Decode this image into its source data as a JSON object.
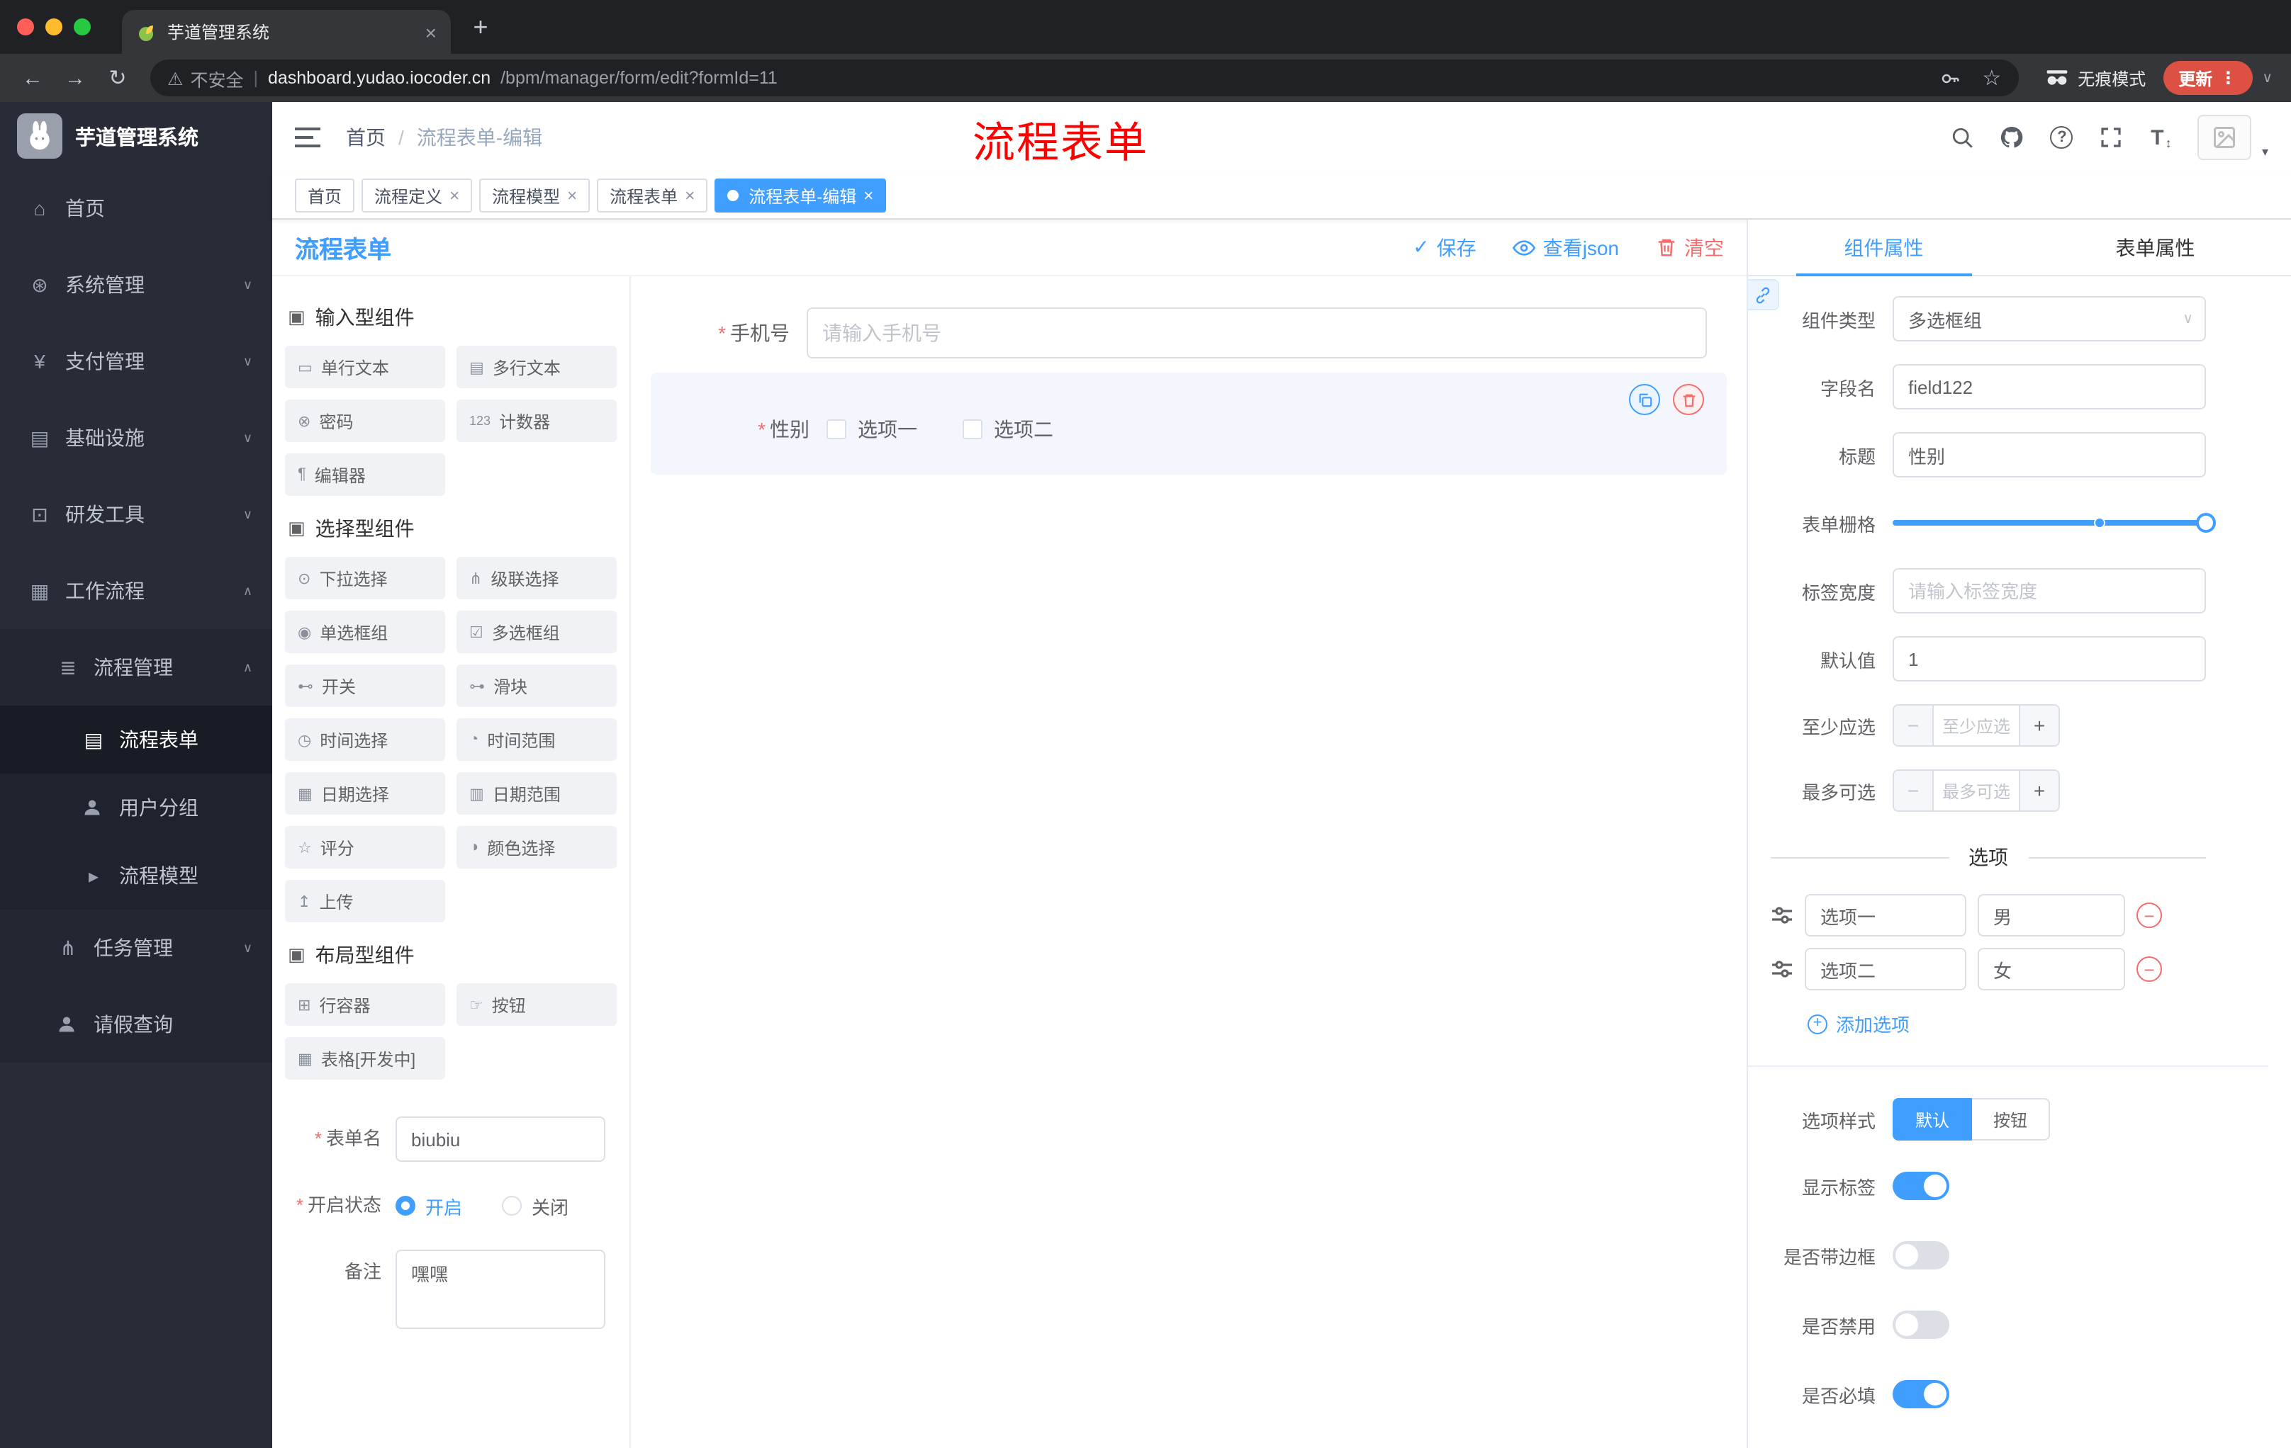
{
  "colors": {
    "accent": "#409EFF",
    "danger": "#F56C6C",
    "annotation_red": "#FF0000",
    "sidebar_bg": "#282C37",
    "update_button": "#DD5144",
    "tag_active": "#409EFF"
  },
  "ui": {
    "close": "×",
    "plus": "+",
    "minus": "−",
    "kebab": "⋮",
    "chevron_down": "∨",
    "caret_down": "▾",
    "check": "✓",
    "star": "☆",
    "back": "←",
    "forward": "→",
    "reload": "↻",
    "pipe": "|",
    "warning": "⚠",
    "updown": "↕",
    "help": "?",
    "font_big": "T",
    "font_small": "T"
  },
  "browser": {
    "tab_title": "芋道管理系统",
    "security_label": "不安全",
    "url_domain": "dashboard.yudao.iocoder.cn",
    "url_path": "/bpm/manager/form/edit?formId=11",
    "incognito_label": "无痕模式",
    "update_label": "更新"
  },
  "sidebar": {
    "logo_title": "芋道管理系统",
    "items": [
      {
        "label": "首页",
        "glyph": "⌂"
      },
      {
        "label": "系统管理",
        "glyph": "⊛",
        "arrow": "∨"
      },
      {
        "label": "支付管理",
        "glyph": "¥",
        "arrow": "∨"
      },
      {
        "label": "基础设施",
        "glyph": "▤",
        "arrow": "∨"
      },
      {
        "label": "研发工具",
        "glyph": "⊡",
        "arrow": "∨"
      },
      {
        "label": "工作流程",
        "glyph": "▦",
        "arrow": "∧"
      },
      {
        "label": "流程管理",
        "glyph": "≣",
        "arrow": "∧"
      },
      {
        "label": "流程表单",
        "glyph": "▤"
      },
      {
        "label": "用户分组",
        "glyph": ""
      },
      {
        "label": "流程模型",
        "glyph": "▸"
      },
      {
        "label": "任务管理",
        "glyph": "⋔",
        "arrow": "∨"
      },
      {
        "label": "请假查询",
        "glyph": ""
      }
    ]
  },
  "header": {
    "crumb_home": "首页",
    "crumb_sep": "/",
    "crumb_current": "流程表单-编辑",
    "annotation": "流程表单"
  },
  "tags": [
    {
      "label": "首页"
    },
    {
      "label": "流程定义"
    },
    {
      "label": "流程模型"
    },
    {
      "label": "流程表单"
    },
    {
      "label": "流程表单-编辑",
      "active": true
    }
  ],
  "designer": {
    "title": "流程表单",
    "save": "保存",
    "view_json": "查看json",
    "clear": "清空",
    "palette": {
      "sections": [
        {
          "icon": "▣",
          "title": "输入型组件"
        },
        {
          "icon": "▣",
          "title": "选择型组件"
        },
        {
          "icon": "▣",
          "title": "布局型组件"
        }
      ],
      "input_items": [
        {
          "label": "单行文本",
          "glyph": "▭"
        },
        {
          "label": "多行文本",
          "glyph": "▤"
        },
        {
          "label": "密码",
          "glyph": "⊗"
        },
        {
          "label": "计数器",
          "glyph": "123"
        },
        {
          "label": "编辑器",
          "glyph": "¶"
        }
      ],
      "select_items": [
        {
          "label": "下拉选择",
          "glyph": "⊙"
        },
        {
          "label": "级联选择",
          "glyph": "⋔"
        },
        {
          "label": "单选框组",
          "glyph": "◉"
        },
        {
          "label": "多选框组",
          "glyph": "☑"
        },
        {
          "label": "开关",
          "glyph": "⊷"
        },
        {
          "label": "滑块",
          "glyph": "⊶"
        },
        {
          "label": "时间选择",
          "glyph": "◷"
        },
        {
          "label": "时间范围",
          "glyph": "◔"
        },
        {
          "label": "日期选择",
          "glyph": "▦"
        },
        {
          "label": "日期范围",
          "glyph": "▥"
        },
        {
          "label": "评分",
          "glyph": "☆"
        },
        {
          "label": "颜色选择",
          "glyph": "◑"
        },
        {
          "label": "上传",
          "glyph": "↥"
        }
      ],
      "layout_items": [
        {
          "label": "行容器",
          "glyph": "⊞"
        },
        {
          "label": "按钮",
          "glyph": "☞"
        },
        {
          "label": "表格[开发中]",
          "glyph": "▦"
        }
      ]
    },
    "meta": {
      "form_name_label": "表单名",
      "form_name_value": "biubiu",
      "status_label": "开启状态",
      "status_on": "开启",
      "status_off": "关闭",
      "remark_label": "备注",
      "remark_value": "嘿嘿"
    },
    "canvas": {
      "phone_label": "手机号",
      "phone_placeholder": "请输入手机号",
      "gender_label": "性别",
      "gender_opt1": "选项一",
      "gender_opt2": "选项二"
    }
  },
  "props": {
    "tab_component": "组件属性",
    "tab_form": "表单属性",
    "component_type_label": "组件类型",
    "component_type_value": "多选框组",
    "field_name_label": "字段名",
    "field_name_value": "field122",
    "title_label": "标题",
    "title_value": "性别",
    "grid_label": "表单栅格",
    "label_width_label": "标签宽度",
    "label_width_placeholder": "请输入标签宽度",
    "default_label": "默认值",
    "default_value": "1",
    "min_label": "至少应选",
    "min_placeholder": "至少应选",
    "max_label": "最多可选",
    "max_placeholder": "最多可选",
    "options_title": "选项",
    "options": [
      {
        "name": "选项一",
        "value": "男"
      },
      {
        "name": "选项二",
        "value": "女"
      }
    ],
    "add_option": "添加选项",
    "style_label": "选项样式",
    "style_default": "默认",
    "style_button": "按钮",
    "toggle_show_label": "显示标签",
    "toggle_border": "是否带边框",
    "toggle_disabled": "是否禁用",
    "toggle_required": "是否必填"
  }
}
